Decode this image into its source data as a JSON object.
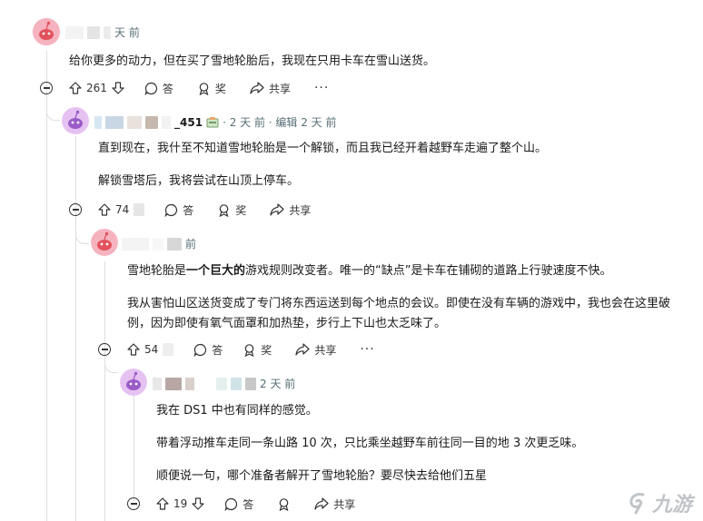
{
  "comments": [
    {
      "username": "",
      "time": "天 前",
      "body": [
        "给你更多的动力，但在买了雪地轮胎后，我现在只用卡车在雪山送货。"
      ],
      "votes": "261",
      "reply_label": "答",
      "award_label": "奖",
      "share_label": "共享",
      "more": "···"
    },
    {
      "username": "_451",
      "time": "· 2 天 前 · 编辑 2 天 前",
      "body": [
        "直到现在，我什至不知道雪地轮胎是一个解锁，而且我已经开着越野车走遍了整个山。",
        "解锁雪塔后，我将尝试在山顶上停车。"
      ],
      "votes": "74",
      "reply_label": "答",
      "award_label": "奖",
      "share_label": "共享",
      "more": "···"
    },
    {
      "username": "",
      "time": "前",
      "body_bold_prefix": "雪地轮胎是",
      "body_bold": "一个巨大的",
      "body_bold_suffix": "游戏规则改变者。唯一的“缺点”是卡车在铺砌的道路上行驶速度不快。",
      "body2": "我从害怕山区送货变成了专门将东西运送到每个地点的会议。即使在没有车辆的游戏中，我也会在这里破例，因为即使有氧气面罩和加热垫，步行上下山也太乏味了。",
      "votes": "54",
      "reply_label": "答",
      "award_label": "奖",
      "share_label": "共享",
      "more": "···"
    },
    {
      "username": "",
      "time": "2 天 前",
      "body": [
        "我在 DS1 中也有同样的感觉。",
        "带着浮动推车走同一条山路 10 次，只比乘坐越野车前往同一目的地 3 次更乏味。",
        "顺便说一句，哪个准备者解开了雪地轮胎？要尽快去给他们五星"
      ],
      "votes": "19",
      "share_label": "共享",
      "reply_label": "答",
      "more": "···"
    }
  ],
  "watermark": "九游",
  "colors": {
    "accent_red": "#e2525c",
    "accent_purple": "#b07fd6",
    "meta_gray": "#576f76"
  }
}
